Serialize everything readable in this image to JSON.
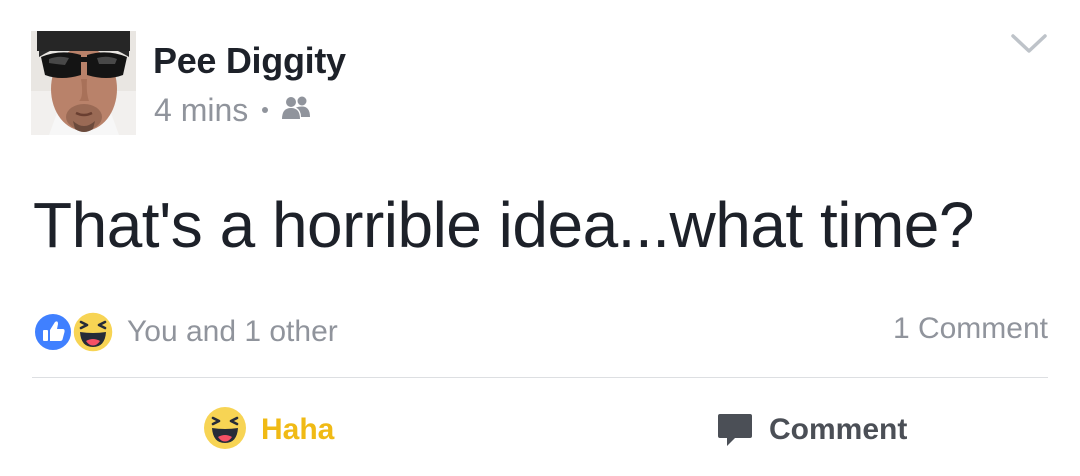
{
  "post": {
    "author": {
      "name": "Pee Diggity",
      "avatar_icon": "profile-photo"
    },
    "timestamp": "4 mins",
    "audience_icon": "friends-icon",
    "menu_icon": "chevron-down-icon",
    "text": "That's a horrible idea...what time?"
  },
  "reactions": {
    "icons": [
      "like-reaction-icon",
      "haha-reaction-icon"
    ],
    "summary": "You and 1 other",
    "comment_count": "1 Comment"
  },
  "actions": {
    "haha_label": "Haha",
    "comment_label": "Comment"
  },
  "colors": {
    "like_blue": "#4080ff",
    "haha_yellow": "#f0ba15",
    "text_primary": "#1d2129",
    "text_secondary": "#90949c",
    "action_gray": "#4b4f56",
    "divider": "#dddfe2"
  }
}
